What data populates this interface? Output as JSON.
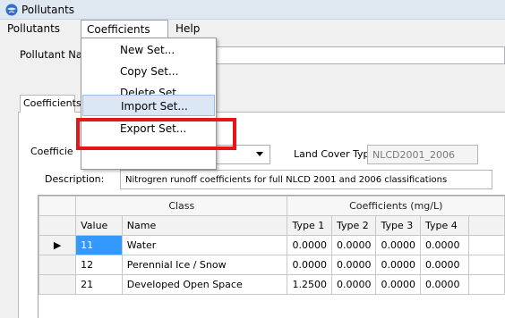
{
  "window": {
    "title": "Pollutants",
    "icon": "globe-icon"
  },
  "menubar": {
    "items": [
      "Pollutants",
      "Coefficients",
      "Help"
    ]
  },
  "dropdown": {
    "items": [
      "New Set...",
      "Copy Set...",
      "Delete Set",
      "Import Set...",
      "Export Set..."
    ],
    "highlighted": "Import Set..."
  },
  "form": {
    "pollutant_name_label": "Pollutant Na",
    "tab_label": "Coefficients",
    "coeff_label": "Coefficie",
    "landcover_label": "Land Cover Type:",
    "landcover_value": "NLCD2001_2006",
    "description_label": "Description:",
    "description_value": "Nitrogren runoff coefficients for full NLCD 2001 and 2006 classifications"
  },
  "grid": {
    "group_headers": {
      "class": "Class",
      "coefficients": "Coefficients (mg/L)"
    },
    "columns": [
      "Value",
      "Name",
      "Type 1",
      "Type 2",
      "Type 3",
      "Type 4"
    ],
    "rows": [
      {
        "value": "11",
        "name": "Water",
        "t1": "0.0000",
        "t2": "0.0000",
        "t3": "0.0000",
        "t4": "0.0000"
      },
      {
        "value": "12",
        "name": "Perennial Ice / Snow",
        "t1": "0.0000",
        "t2": "0.0000",
        "t3": "0.0000",
        "t4": "0.0000"
      },
      {
        "value": "21",
        "name": "Developed Open Space",
        "t1": "1.2500",
        "t2": "0.0000",
        "t3": "0.0000",
        "t4": "0.0000"
      }
    ],
    "row_indicator": "▶"
  },
  "colors": {
    "highlight": "#e8141a",
    "selection": "#3399ff"
  }
}
